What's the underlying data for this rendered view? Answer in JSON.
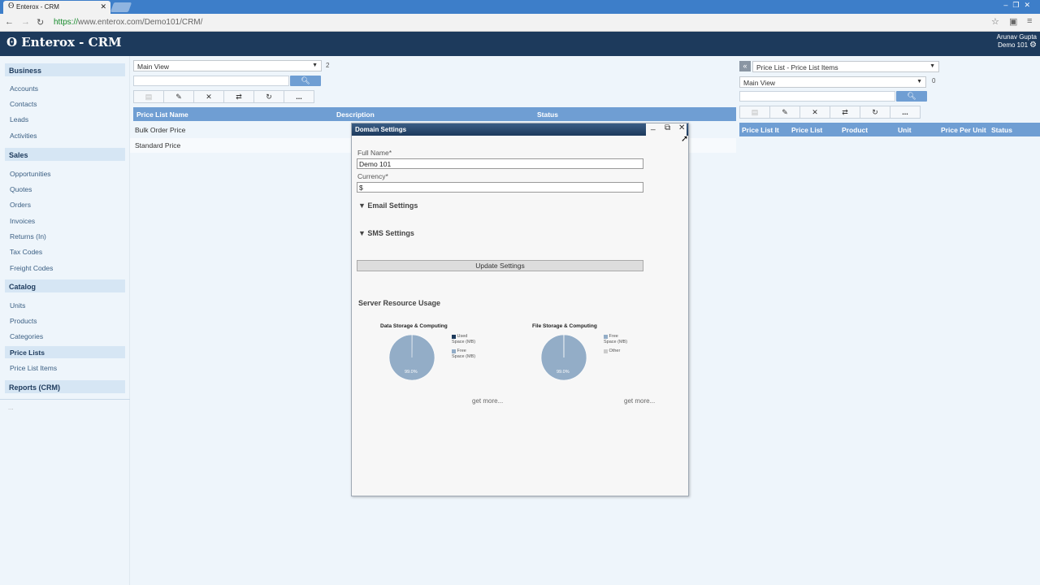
{
  "browser": {
    "tab_title": "Enterox - CRM",
    "url_scheme": "https://",
    "url_rest": "www.enterox.com/Demo101/CRM/"
  },
  "app": {
    "title": "Enterox - CRM",
    "user_name": "Arunav Gupta",
    "user_domain": "Demo 101"
  },
  "sidebar": {
    "sections": [
      {
        "label": "Business",
        "items": [
          "Accounts",
          "Contacts",
          "Leads",
          "Activities"
        ]
      },
      {
        "label": "Sales",
        "items": [
          "Opportunities",
          "Quotes",
          "Orders",
          "Invoices",
          "Returns (In)",
          "Tax Codes",
          "Freight Codes"
        ]
      },
      {
        "label": "Catalog",
        "items": [
          "Units",
          "Products",
          "Categories",
          "Price Lists",
          "Price List Items"
        ]
      },
      {
        "label": "Reports (CRM)",
        "items": []
      }
    ],
    "active_item": "Price Lists",
    "footer": "..."
  },
  "main": {
    "view_select": "Main View",
    "count": "2",
    "toolbar_more": "...",
    "columns": [
      "Price List Name",
      "Description",
      "Status"
    ],
    "rows": [
      "Bulk Order Price",
      "Standard Price"
    ]
  },
  "dialog": {
    "title": "Domain Settings",
    "full_name_label": "Full Name*",
    "full_name_value": "Demo 101",
    "currency_label": "Currency*",
    "currency_value": "$",
    "email_settings": "▼ Email Settings",
    "sms_settings": "▼ SMS Settings",
    "update_button": "Update Settings",
    "server_usage_title": "Server Resource Usage",
    "charts_more": "get more..."
  },
  "chart_data": [
    {
      "type": "pie",
      "title": "Data Storage & Computing",
      "labels": [
        "Used Space (MB)",
        "Free Space (MB)"
      ],
      "values": [
        0.1,
        99.9
      ],
      "slice_label": "99.0%",
      "colors": [
        "#1d3a5c",
        "#93adc7"
      ]
    },
    {
      "type": "pie",
      "title": "File Storage & Computing",
      "labels": [
        "Free Space (MB)",
        "Other"
      ],
      "values": [
        99.9,
        0.1
      ],
      "slice_label": "99.0%",
      "colors": [
        "#93adc7",
        "#cccccc"
      ]
    }
  ],
  "right_panel": {
    "related_select": "Price List - Price List Items",
    "view_select": "Main View",
    "count": "0",
    "toolbar_more": "...",
    "columns": [
      "Price List It",
      "Price List",
      "Product",
      "Unit",
      "Price Per Unit",
      "Status"
    ]
  }
}
